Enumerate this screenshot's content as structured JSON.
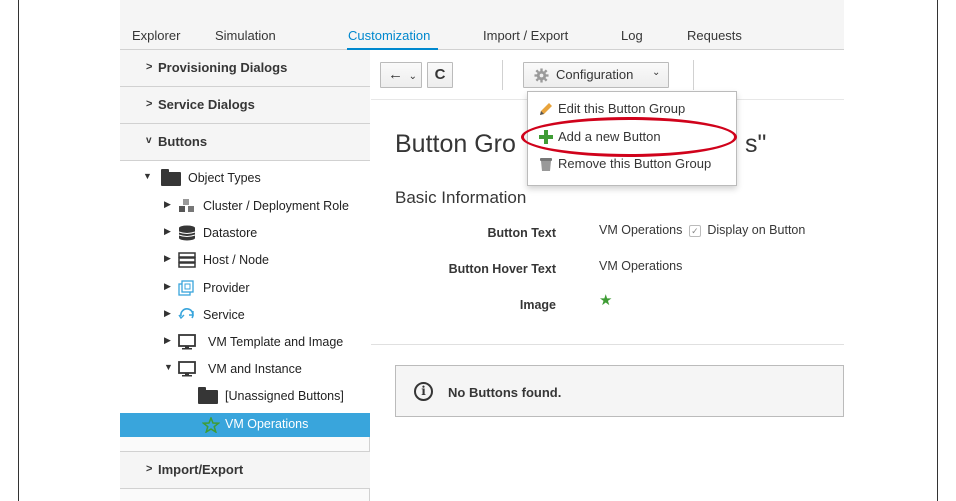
{
  "nav": {
    "tabs": [
      "Explorer",
      "Simulation",
      "Customization",
      "Import / Export",
      "Log",
      "Requests"
    ],
    "active": "Customization"
  },
  "sidebar": {
    "accordions": {
      "provisioning": "Provisioning Dialogs",
      "service": "Service Dialogs",
      "buttons": "Buttons",
      "import_export": "Import/Export"
    },
    "chevron_closed": ">",
    "chevron_open": "v",
    "tree": [
      {
        "label": "Object Types",
        "icon": "folder-icon"
      },
      {
        "label": "Cluster / Deployment Role",
        "icon": "cluster-icon"
      },
      {
        "label": "Datastore",
        "icon": "datastore-icon"
      },
      {
        "label": "Host / Node",
        "icon": "host-icon"
      },
      {
        "label": "Provider",
        "icon": "provider-icon"
      },
      {
        "label": "Service",
        "icon": "service-icon"
      },
      {
        "label": "VM Template and Image",
        "icon": "monitor-icon"
      },
      {
        "label": "VM and Instance",
        "icon": "monitor-icon"
      },
      {
        "label": "[Unassigned Buttons]",
        "icon": "folder-icon"
      },
      {
        "label": "VM Operations",
        "icon": "star-outline-icon"
      }
    ]
  },
  "toolbar": {
    "back": "←",
    "caret": "⌄",
    "reload": "C",
    "configuration": "Configuration"
  },
  "dropdown": {
    "items": [
      {
        "label": "Edit this Button Group",
        "icon": "pencil-icon"
      },
      {
        "label": "Add a new Button",
        "icon": "plus-icon"
      },
      {
        "label": "Remove this Button Group",
        "icon": "trash-icon"
      }
    ]
  },
  "main": {
    "title_left": "Button Gro",
    "title_right": "s\"",
    "section": "Basic Information",
    "fields": [
      {
        "label": "Button Text",
        "value": "VM Operations",
        "extra": "Display on Button"
      },
      {
        "label": "Button Hover Text",
        "value": "VM Operations"
      },
      {
        "label": "Image",
        "value": "★"
      }
    ],
    "checkmark": "✓",
    "alert": "No Buttons found.",
    "info_glyph": "i"
  },
  "colors": {
    "accent": "#0088ce",
    "selected": "#39a5dc",
    "highlight_ring": "#d0021b",
    "star": "#3f9c35"
  }
}
